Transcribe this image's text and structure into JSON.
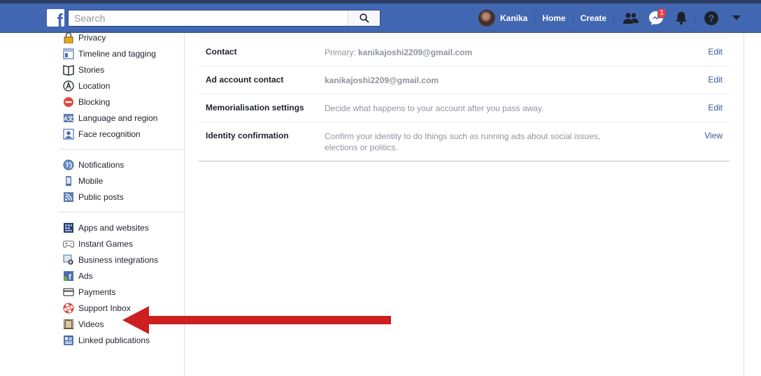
{
  "header": {
    "search_placeholder": "Search",
    "user_name": "Kanika",
    "home": "Home",
    "create": "Create",
    "messages_badge": "1",
    "colors": {
      "bar": "#4267b2",
      "badge": "#fa3e3e",
      "arrow": "#cc1f1f"
    }
  },
  "sidebar": {
    "group1": [
      {
        "label": "Privacy",
        "icon": "lock-icon"
      },
      {
        "label": "Timeline and tagging",
        "icon": "timeline-icon"
      },
      {
        "label": "Stories",
        "icon": "book-icon"
      },
      {
        "label": "Location",
        "icon": "location-icon"
      },
      {
        "label": "Blocking",
        "icon": "blocking-icon"
      },
      {
        "label": "Language and region",
        "icon": "language-icon"
      },
      {
        "label": "Face recognition",
        "icon": "face-icon"
      }
    ],
    "group2": [
      {
        "label": "Notifications",
        "icon": "globe-icon"
      },
      {
        "label": "Mobile",
        "icon": "mobile-icon"
      },
      {
        "label": "Public posts",
        "icon": "rss-icon"
      }
    ],
    "group3": [
      {
        "label": "Apps and websites",
        "icon": "apps-icon"
      },
      {
        "label": "Instant Games",
        "icon": "gamepad-icon"
      },
      {
        "label": "Business integrations",
        "icon": "gear-icon"
      },
      {
        "label": "Ads",
        "icon": "ads-icon"
      },
      {
        "label": "Payments",
        "icon": "card-icon"
      },
      {
        "label": "Support Inbox",
        "icon": "lifebuoy-icon"
      },
      {
        "label": "Videos",
        "icon": "film-icon"
      },
      {
        "label": "Linked publications",
        "icon": "publication-icon"
      }
    ]
  },
  "settings": [
    {
      "label": "Contact",
      "value_prefix": "Primary: ",
      "value_bold": "kanikajoshi2209@gmail.com",
      "value": "",
      "action": "Edit"
    },
    {
      "label": "Ad account contact",
      "value_prefix": "",
      "value_bold": "kanikajoshi2209@gmail.com",
      "value": "",
      "action": "Edit"
    },
    {
      "label": "Memorialisation settings",
      "value_prefix": "",
      "value_bold": "",
      "value": "Decide what happens to your account after you pass away.",
      "action": "Edit"
    },
    {
      "label": "Identity confirmation",
      "value_prefix": "",
      "value_bold": "",
      "value": "Confirm your identity to do things such as running ads about social issues, elections or politics.",
      "action": "View"
    }
  ]
}
